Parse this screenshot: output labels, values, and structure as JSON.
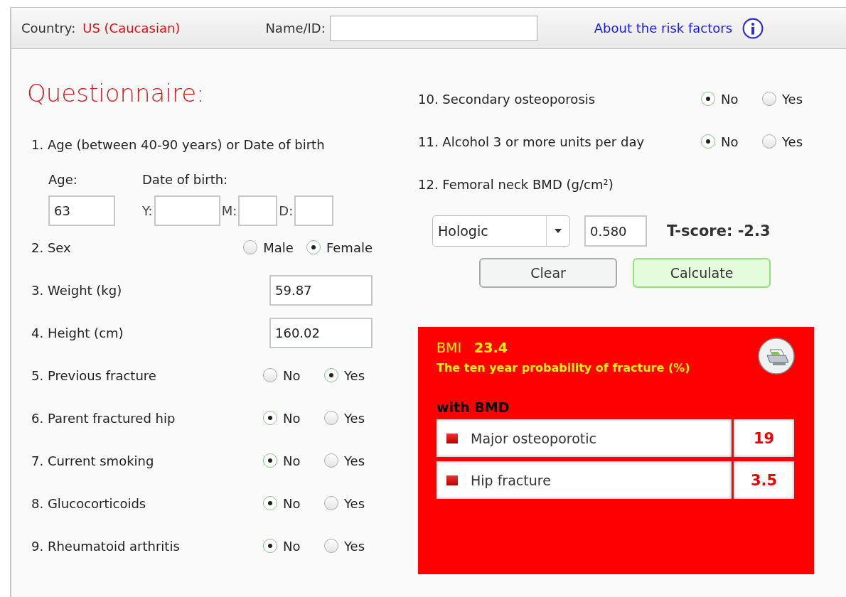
{
  "header": {
    "country_label": "Country:",
    "country": "US (Caucasian)",
    "name_label": "Name/ID:",
    "about_link": "About the risk factors"
  },
  "title": "Questionnaire:",
  "age_question": {
    "label": "1. Age (between 40-90 years) or Date of birth",
    "age_label": "Age:",
    "age_value": "63",
    "dob_label": "Date of birth:",
    "dob_fields": [
      {
        "label": "Y:"
      },
      {
        "label": "M:"
      },
      {
        "label": "D:"
      }
    ]
  },
  "left_questions": [
    {
      "kind": "choice",
      "label": "2. Sex",
      "options": [
        {
          "label": "Male",
          "selected": false
        },
        {
          "label": "Female",
          "selected": true
        }
      ]
    },
    {
      "kind": "field",
      "label": "3. Weight (kg)",
      "value": "59.87"
    },
    {
      "kind": "field",
      "label": "4. Height (cm)",
      "value": "160.02"
    },
    {
      "kind": "choice",
      "label": "5. Previous fracture",
      "options": [
        {
          "label": "No",
          "selected": false
        },
        {
          "label": "Yes",
          "selected": true
        }
      ]
    },
    {
      "kind": "choice",
      "label": "6. Parent fractured hip",
      "options": [
        {
          "label": "No",
          "selected": true
        },
        {
          "label": "Yes",
          "selected": false
        }
      ]
    },
    {
      "kind": "choice",
      "label": "7. Current smoking",
      "options": [
        {
          "label": "No",
          "selected": true
        },
        {
          "label": "Yes",
          "selected": false
        }
      ]
    },
    {
      "kind": "choice",
      "label": "8. Glucocorticoids",
      "options": [
        {
          "label": "No",
          "selected": true
        },
        {
          "label": "Yes",
          "selected": false
        }
      ]
    },
    {
      "kind": "choice",
      "label": "9. Rheumatoid arthritis",
      "options": [
        {
          "label": "No",
          "selected": true
        },
        {
          "label": "Yes",
          "selected": false
        }
      ]
    }
  ],
  "right_questions": [
    {
      "kind": "choice",
      "label": "10. Secondary osteoporosis",
      "options": [
        {
          "label": "No",
          "selected": true
        },
        {
          "label": "Yes",
          "selected": false
        }
      ]
    },
    {
      "kind": "choice",
      "label": "11. Alcohol 3 or more units per day",
      "options": [
        {
          "label": "No",
          "selected": true
        },
        {
          "label": "Yes",
          "selected": false
        }
      ]
    },
    {
      "kind": "text",
      "label": "12. Femoral neck BMD  (g/cm²)"
    }
  ],
  "bmd": {
    "device": "Hologic",
    "value": "0.580",
    "tscore": "T-score: -2.3"
  },
  "buttons": [
    {
      "label": "Clear",
      "kind": "plain"
    },
    {
      "label": "Calculate",
      "kind": "primary"
    }
  ],
  "result": {
    "bmi_label": "BMI",
    "bmi_value": "23.4",
    "subtitle": "The ten year probability of fracture (%)",
    "section": "with BMD",
    "rows": [
      {
        "label": "Major osteoporotic",
        "value": "19"
      },
      {
        "label": "Hip fracture",
        "value": "3.5"
      }
    ]
  }
}
